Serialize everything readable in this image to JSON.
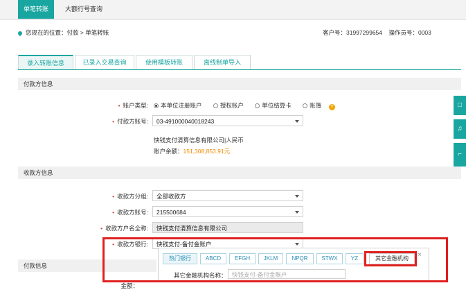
{
  "top_tabs": [
    "单笔转账",
    "大额行号查询"
  ],
  "location": {
    "prefix": "您现在的位置：付款 > 单笔转账"
  },
  "account": {
    "customer_no": "客户号：31997299654",
    "operator_no": "操作员号：0003"
  },
  "tabs": [
    "录入转账信息",
    "已录入交易查询",
    "使用模板转账",
    "离线制单导入"
  ],
  "payer_section": "付款方信息",
  "payer": {
    "account_type_label": "账户类型:",
    "account_type_options": [
      "本单位注册账户",
      "授权账户",
      "单位结算卡",
      "账簿"
    ],
    "selected_option": "本单位注册账户",
    "help_icon": "?",
    "account_no_label": "付款方账号:",
    "account_no_value": "03-491000040018243",
    "account_name": "快钱支付清算信息有限公司|人民币",
    "balance_label": "账户余额：",
    "balance_value": "151,308,853.91元"
  },
  "payee_section": "收款方信息",
  "payee": {
    "group_label": "收款方分组:",
    "group_value": "全部收款方",
    "account_no_label": "收款方账号:",
    "account_no_value": "215500684",
    "name_label": "收款方户名全称:",
    "name_value": "快钱支付清算信息有限公司",
    "bank_label": "收款方银行:",
    "bank_value": "快钱支付-备付金账户"
  },
  "payment_section": "付款信息",
  "bank_picker": {
    "tabs": [
      "热门银行",
      "ABCD",
      "EFGH",
      "JKLM",
      "NPQR",
      "STWX",
      "YZ",
      "其它金融机构"
    ],
    "institution_label": "其它金融机构名称：",
    "institution_placeholder": "快钱支付-备付金账户",
    "close": "×"
  },
  "amount_label": "金额：",
  "side_buttons": [
    "□",
    "♫",
    "⌐"
  ],
  "colors": {
    "accent": "#19a6a0",
    "highlight": "#e02020",
    "balance": "#f08a00"
  }
}
